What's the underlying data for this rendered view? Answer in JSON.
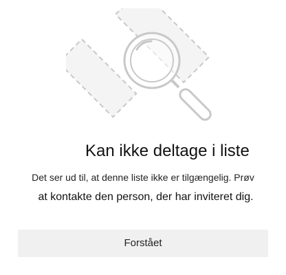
{
  "dialog": {
    "illustration_icon": "magnifier-over-broken-list-icon",
    "title": "Kan ikke deltage i liste",
    "message_line1": "Det ser ud til, at denne liste ikke er tilgængelig. Prøv",
    "message_line2": "at kontakte den person, der har inviteret dig.",
    "ok_label": "Forstået"
  },
  "colors": {
    "illustration_stroke": "#c8c8c8",
    "illustration_fill": "#f4f4f4",
    "button_bg": "#f0f0f0",
    "text": "#1b1b1b"
  }
}
